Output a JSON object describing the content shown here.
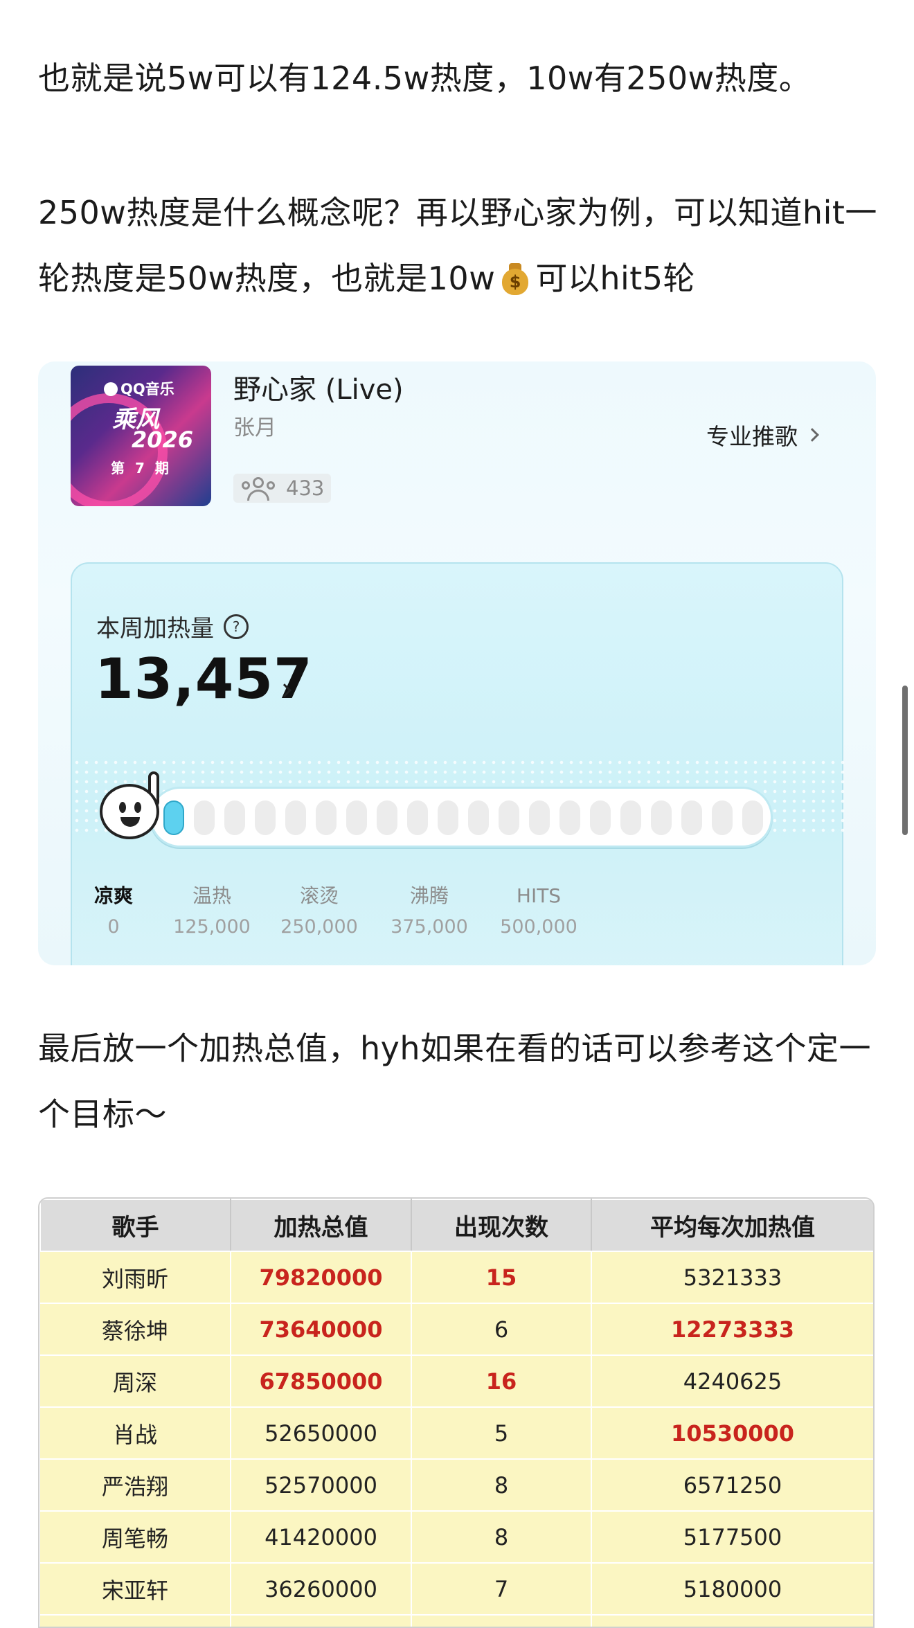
{
  "paragraphs": {
    "p1": "也就是说5w可以有124.5w热度，10w有250w热度。",
    "p2a": "250w热度是什么概念呢？再以野心家为例，可以知道hit一轮热度是50w热度，也就是10w",
    "p2b": "可以hit5轮",
    "p3": "最后放一个加热总值，hyh如果在看的话可以参考这个定一个目标～"
  },
  "song_card": {
    "cover": {
      "brand": "QQ音乐",
      "show": "乘风",
      "year": "2026",
      "episode": "第 7 期"
    },
    "title": "野心家 (Live)",
    "artist": "张月",
    "fans_count": "433",
    "pro_link": "专业推歌",
    "heat": {
      "label": "本周加热量",
      "value": "13,457",
      "progress_segments_total": 20,
      "progress_segments_filled": 1,
      "stages": [
        {
          "name": "凉爽",
          "value": "0",
          "active": true
        },
        {
          "name": "温热",
          "value": "125,000",
          "active": false
        },
        {
          "name": "滚烫",
          "value": "250,000",
          "active": false
        },
        {
          "name": "沸腾",
          "value": "375,000",
          "active": false
        },
        {
          "name": "HITS",
          "value": "500,000",
          "active": false
        }
      ]
    }
  },
  "table": {
    "headers": [
      "歌手",
      "加热总值",
      "出现次数",
      "平均每次加热值"
    ],
    "rows": [
      {
        "singer": "刘雨昕",
        "total": "79820000",
        "count": "15",
        "avg": "5321333",
        "hl": [
          false,
          true,
          true,
          false
        ]
      },
      {
        "singer": "蔡徐坤",
        "total": "73640000",
        "count": "6",
        "avg": "12273333",
        "hl": [
          false,
          true,
          false,
          true
        ]
      },
      {
        "singer": "周深",
        "total": "67850000",
        "count": "16",
        "avg": "4240625",
        "hl": [
          false,
          true,
          true,
          false
        ]
      },
      {
        "singer": "肖战",
        "total": "52650000",
        "count": "5",
        "avg": "10530000",
        "hl": [
          false,
          false,
          false,
          true
        ]
      },
      {
        "singer": "严浩翔",
        "total": "52570000",
        "count": "8",
        "avg": "6571250",
        "hl": [
          false,
          false,
          false,
          false
        ]
      },
      {
        "singer": "周笔畅",
        "total": "41420000",
        "count": "8",
        "avg": "5177500",
        "hl": [
          false,
          false,
          false,
          false
        ]
      },
      {
        "singer": "宋亚轩",
        "total": "36260000",
        "count": "7",
        "avg": "5180000",
        "hl": [
          false,
          false,
          false,
          false
        ]
      }
    ]
  },
  "colors": {
    "highlight_red": "#c8241d",
    "table_row_bg": "#fbf6c2",
    "table_header_bg": "#dcdcdc",
    "progress_on": "#5dd1ef"
  }
}
